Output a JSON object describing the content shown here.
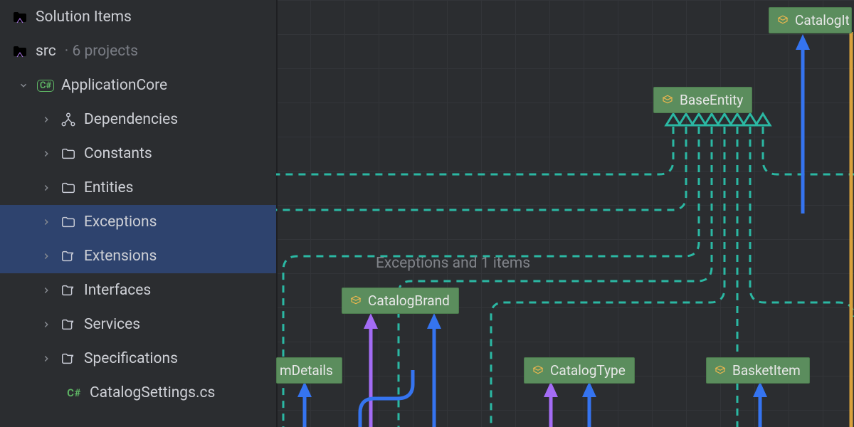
{
  "tree": {
    "solution_items": "Solution Items",
    "src_label": "src",
    "src_meta": "· 6 projects",
    "project": "ApplicationCore",
    "project_badge": "C#",
    "nodes": {
      "dependencies": "Dependencies",
      "constants": "Constants",
      "entities": "Entities",
      "exceptions": "Exceptions",
      "extensions": "Extensions",
      "interfaces": "Interfaces",
      "services": "Services",
      "specifications": "Specifications",
      "catalog_settings": "CatalogSettings.cs",
      "cs_badge": "C#"
    }
  },
  "canvas": {
    "ghost": "Exceptions and 1 items",
    "nodes": {
      "base_entity": "BaseEntity",
      "catalog_item_cut": "CatalogIt",
      "catalog_brand": "CatalogBrand",
      "catalog_type": "CatalogType",
      "basket_item": "BasketItem",
      "em_details": "mDetails"
    }
  }
}
